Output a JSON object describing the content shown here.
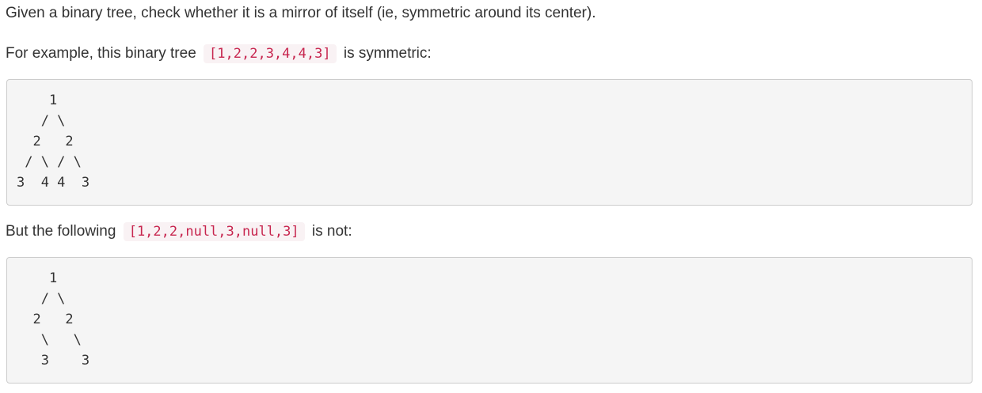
{
  "intro": "Given a binary tree, check whether it is a mirror of itself (ie, symmetric around its center).",
  "example1": {
    "prefix": "For example, this binary tree",
    "code": "[1,2,2,3,4,4,3]",
    "suffix": "is symmetric:",
    "tree": "    1\n   / \\\n  2   2\n / \\ / \\\n3  4 4  3"
  },
  "example2": {
    "prefix": "But the following",
    "code": "[1,2,2,null,3,null,3]",
    "suffix": "is not:",
    "tree": "    1\n   / \\\n  2   2\n   \\   \\\n   3    3"
  }
}
